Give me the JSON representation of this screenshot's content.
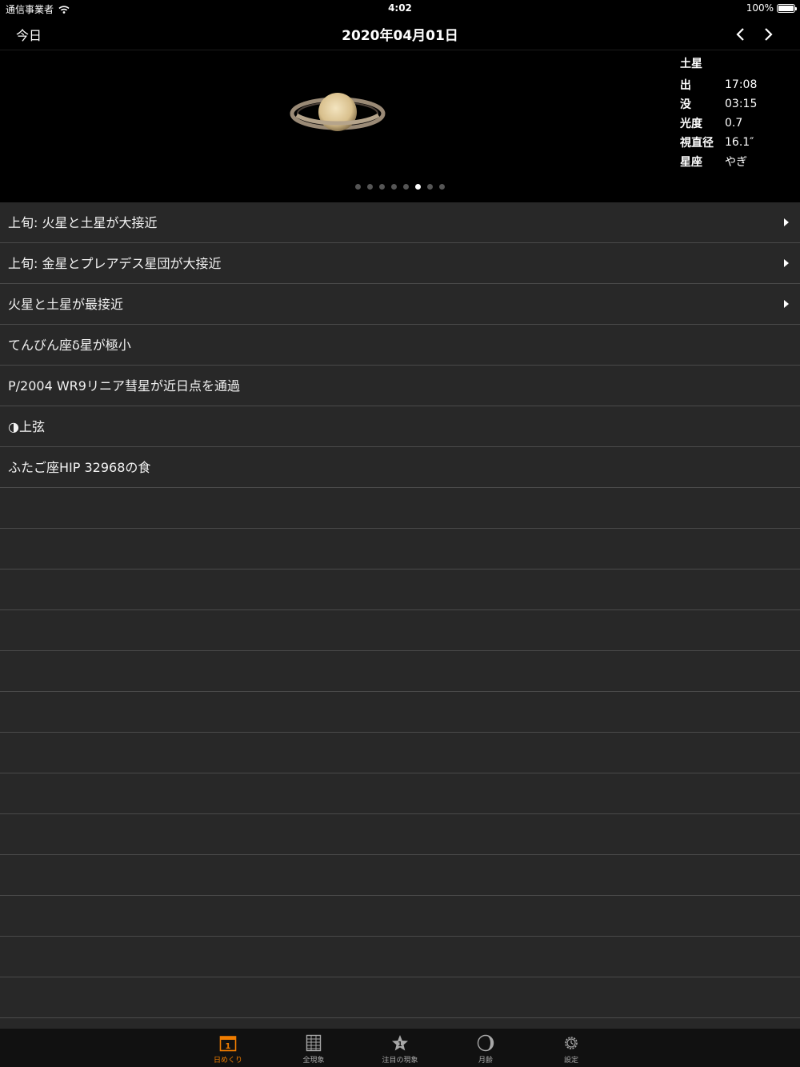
{
  "status_bar": {
    "carrier": "通信事業者",
    "time": "4:02",
    "battery": "100%",
    "battery_level": 1.0
  },
  "nav": {
    "today_label": "今日",
    "title": "2020年04月01日"
  },
  "planet": {
    "name": "土星",
    "rows": [
      {
        "label": "出",
        "value": "17:08"
      },
      {
        "label": "没",
        "value": "03:15"
      },
      {
        "label": "光度",
        "value": "0.7"
      },
      {
        "label": "視直径",
        "value": "16.1″"
      },
      {
        "label": "星座",
        "value": "やぎ"
      }
    ],
    "page_count": 8,
    "page_index": 5
  },
  "events": [
    {
      "label": "上旬: 火星と土星が大接近",
      "has_detail": true
    },
    {
      "label": "上旬: 金星とプレアデス星団が大接近",
      "has_detail": true
    },
    {
      "label": "火星と土星が最接近",
      "has_detail": true
    },
    {
      "label": "てんびん座δ星が極小",
      "has_detail": false
    },
    {
      "label": "P/2004 WR9リニア彗星が近日点を通過",
      "has_detail": false
    },
    {
      "label": "◑上弦",
      "has_detail": false
    },
    {
      "label": "ふたご座HIP 32968の食",
      "has_detail": false
    }
  ],
  "tabs": [
    {
      "label": "日めくり",
      "icon": "calendar-icon",
      "active": true
    },
    {
      "label": "全現象",
      "icon": "list-grid-icon",
      "active": false
    },
    {
      "label": "注目の現象",
      "icon": "star-badge-icon",
      "active": false
    },
    {
      "label": "月齢",
      "icon": "moon-icon",
      "active": false
    },
    {
      "label": "設定",
      "icon": "gear-icon",
      "active": false
    }
  ],
  "colors": {
    "accent": "#f07d00",
    "list_bg": "#282828",
    "separator": "#4a4a4a"
  }
}
